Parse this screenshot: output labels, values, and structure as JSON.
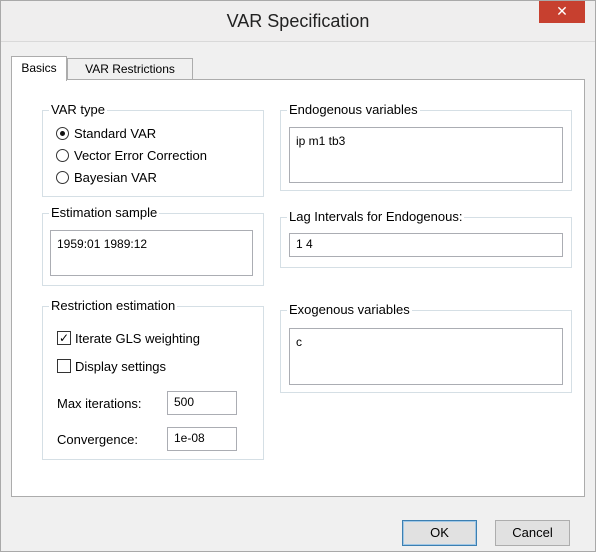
{
  "window": {
    "title": "VAR Specification",
    "close_glyph": "✕"
  },
  "tabs": [
    {
      "label": "Basics",
      "active": true
    },
    {
      "label": "VAR Restrictions",
      "active": false
    }
  ],
  "var_type": {
    "label": "VAR type",
    "options": [
      {
        "label": "Standard VAR",
        "checked": true
      },
      {
        "label": "Vector Error Correction",
        "checked": false
      },
      {
        "label": "Bayesian VAR",
        "checked": false
      }
    ]
  },
  "estimation_sample": {
    "label": "Estimation sample",
    "value": "1959:01 1989:12"
  },
  "restriction_estimation": {
    "label": "Restriction estimation",
    "iterate_gls": {
      "label": "Iterate GLS weighting",
      "checked": true
    },
    "display_settings": {
      "label": "Display settings",
      "checked": false
    },
    "max_iterations": {
      "label": "Max iterations:",
      "value": "500"
    },
    "convergence": {
      "label": "Convergence:",
      "value": "1e-08"
    }
  },
  "endogenous": {
    "label": "Endogenous variables",
    "value": "ip m1 tb3"
  },
  "lag_intervals": {
    "label": "Lag Intervals for Endogenous:",
    "value": "1 4"
  },
  "exogenous": {
    "label": "Exogenous variables",
    "value": "c"
  },
  "buttons": {
    "ok": "OK",
    "cancel": "Cancel"
  },
  "icons": {
    "checkmark": "check-icon"
  }
}
